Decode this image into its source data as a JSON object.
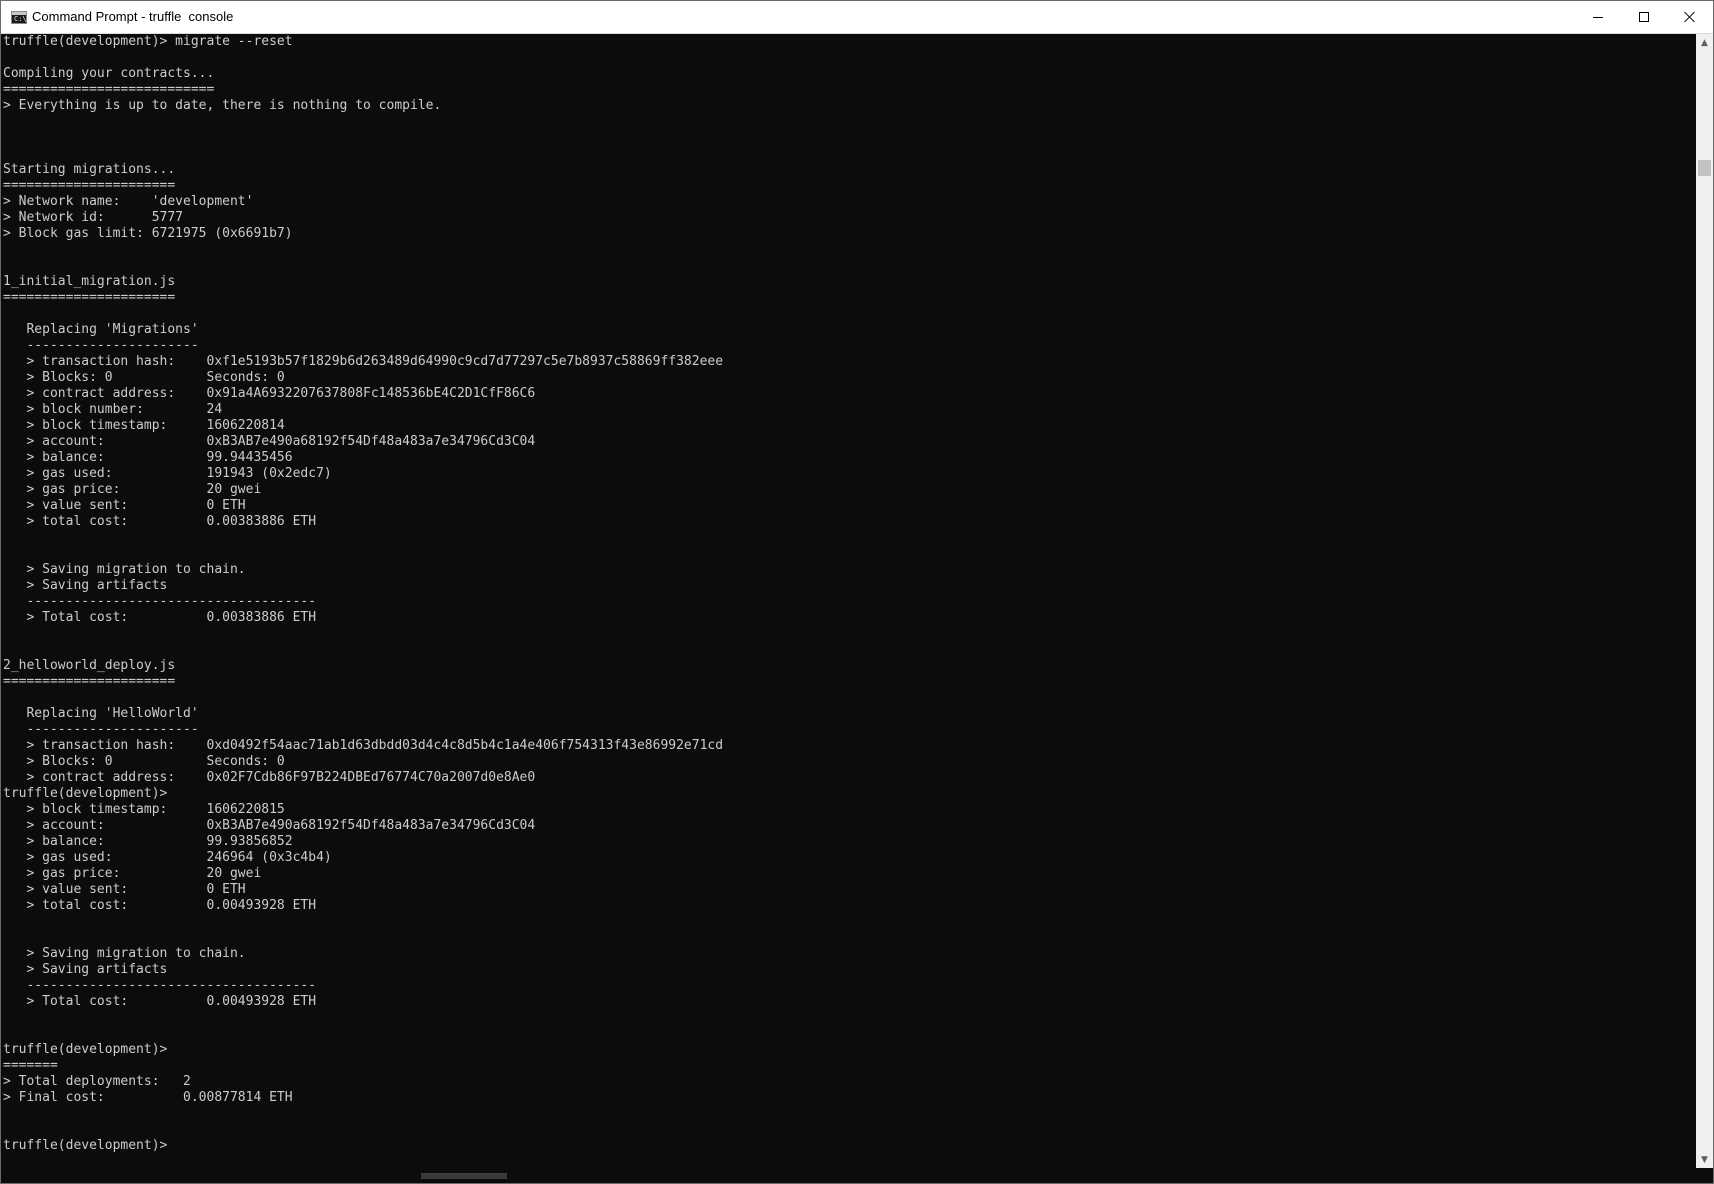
{
  "window": {
    "title": "Command Prompt - truffle  console",
    "icon_name": "command-prompt-icon",
    "icon_glyph": "C:\\",
    "controls": {
      "minimize": "minimize-icon",
      "maximize": "maximize-icon",
      "close": "close-icon"
    }
  },
  "console": {
    "lines": [
      "truffle(development)> migrate --reset",
      "",
      "Compiling your contracts...",
      "===========================",
      "> Everything is up to date, there is nothing to compile.",
      "",
      "",
      "",
      "Starting migrations...",
      "======================",
      "> Network name:    'development'",
      "> Network id:      5777",
      "> Block gas limit: 6721975 (0x6691b7)",
      "",
      "",
      "1_initial_migration.js",
      "======================",
      "",
      "   Replacing 'Migrations'",
      "   ----------------------",
      "   > transaction hash:    0xf1e5193b57f1829b6d263489d64990c9cd7d77297c5e7b8937c58869ff382eee",
      "   > Blocks: 0            Seconds: 0",
      "   > contract address:    0x91a4A6932207637808Fc148536bE4C2D1CfF86C6",
      "   > block number:        24",
      "   > block timestamp:     1606220814",
      "   > account:             0xB3AB7e490a68192f54Df48a483a7e34796Cd3C04",
      "   > balance:             99.94435456",
      "   > gas used:            191943 (0x2edc7)",
      "   > gas price:           20 gwei",
      "   > value sent:          0 ETH",
      "   > total cost:          0.00383886 ETH",
      "",
      "",
      "   > Saving migration to chain.",
      "   > Saving artifacts",
      "   -------------------------------------",
      "   > Total cost:          0.00383886 ETH",
      "",
      "",
      "2_helloworld_deploy.js",
      "======================",
      "",
      "   Replacing 'HelloWorld'",
      "   ----------------------",
      "   > transaction hash:    0xd0492f54aac71ab1d63dbdd03d4c4c8d5b4c1a4e406f754313f43e86992e71cd",
      "   > Blocks: 0            Seconds: 0",
      "   > contract address:    0x02F7Cdb86F97B224DBEd76774C70a2007d0e8Ae0",
      "truffle(development)>",
      "   > block timestamp:     1606220815",
      "   > account:             0xB3AB7e490a68192f54Df48a483a7e34796Cd3C04",
      "   > balance:             99.93856852",
      "   > gas used:            246964 (0x3c4b4)",
      "   > gas price:           20 gwei",
      "   > value sent:          0 ETH",
      "   > total cost:          0.00493928 ETH",
      "",
      "",
      "   > Saving migration to chain.",
      "   > Saving artifacts",
      "   -------------------------------------",
      "   > Total cost:          0.00493928 ETH",
      "",
      "",
      "truffle(development)>",
      "=======",
      "> Total deployments:   2",
      "> Final cost:          0.00877814 ETH",
      "",
      "",
      "truffle(development)>"
    ]
  },
  "scrollbar": {
    "up_arrow": "scroll-up-arrow-icon",
    "down_arrow": "scroll-down-arrow-icon"
  }
}
